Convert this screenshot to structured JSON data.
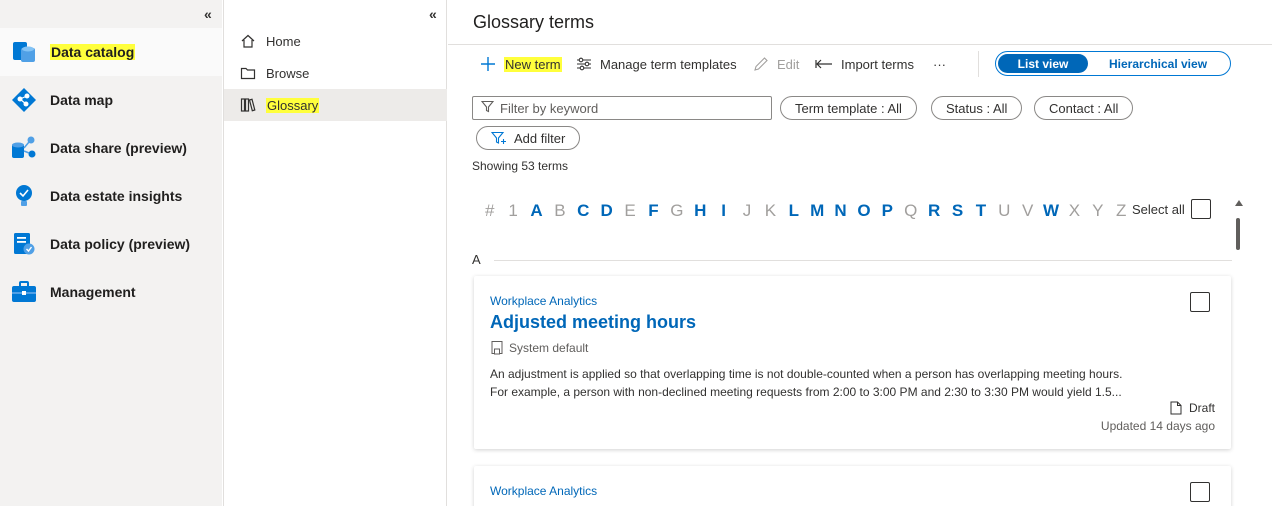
{
  "leftnav": {
    "items": [
      {
        "label": "Data catalog",
        "icon": "data-catalog-icon"
      },
      {
        "label": "Data map",
        "icon": "data-map-icon"
      },
      {
        "label": "Data share (preview)",
        "icon": "data-share-icon"
      },
      {
        "label": "Data estate insights",
        "icon": "insights-icon"
      },
      {
        "label": "Data policy (preview)",
        "icon": "data-policy-icon"
      },
      {
        "label": "Management",
        "icon": "management-icon"
      }
    ]
  },
  "subnav": {
    "items": [
      {
        "label": "Home",
        "icon": "home-icon"
      },
      {
        "label": "Browse",
        "icon": "folder-icon"
      },
      {
        "label": "Glossary",
        "icon": "book-icon"
      }
    ]
  },
  "main": {
    "title": "Glossary terms",
    "toolbar": {
      "new_term": "New term",
      "manage_templates": "Manage term templates",
      "edit": "Edit",
      "import_terms": "Import terms",
      "more": "···",
      "list_view": "List view",
      "hierarchical_view": "Hierarchical view"
    },
    "filter": {
      "placeholder": "Filter by keyword",
      "term_template": "Term template : All",
      "status": "Status : All",
      "contact": "Contact : All",
      "add_filter": "Add filter"
    },
    "showing": "Showing 53 terms",
    "alphabet": [
      {
        "c": "#",
        "on": false
      },
      {
        "c": "1",
        "on": false
      },
      {
        "c": "A",
        "on": true
      },
      {
        "c": "B",
        "on": false
      },
      {
        "c": "C",
        "on": true
      },
      {
        "c": "D",
        "on": true
      },
      {
        "c": "E",
        "on": false
      },
      {
        "c": "F",
        "on": true
      },
      {
        "c": "G",
        "on": false
      },
      {
        "c": "H",
        "on": true
      },
      {
        "c": "I",
        "on": true
      },
      {
        "c": "J",
        "on": false
      },
      {
        "c": "K",
        "on": false
      },
      {
        "c": "L",
        "on": true
      },
      {
        "c": "M",
        "on": true
      },
      {
        "c": "N",
        "on": true
      },
      {
        "c": "O",
        "on": true
      },
      {
        "c": "P",
        "on": true
      },
      {
        "c": "Q",
        "on": false
      },
      {
        "c": "R",
        "on": true
      },
      {
        "c": "S",
        "on": true
      },
      {
        "c": "T",
        "on": true
      },
      {
        "c": "U",
        "on": false
      },
      {
        "c": "V",
        "on": false
      },
      {
        "c": "W",
        "on": true
      },
      {
        "c": "X",
        "on": false
      },
      {
        "c": "Y",
        "on": false
      },
      {
        "c": "Z",
        "on": false
      }
    ],
    "select_all": "Select all",
    "section_letter": "A",
    "terms": [
      {
        "template": "Workplace Analytics",
        "name": "Adjusted meeting hours",
        "source": "System default",
        "description_line1": "An adjustment is applied so that overlapping time is not double-counted when a person has overlapping meeting hours.",
        "description_line2": "For example, a person with non-declined meeting requests from 2:00 to 3:00 PM and 2:30 to 3:30 PM would yield 1.5...",
        "status": "Draft",
        "updated": "Updated 14 days ago"
      },
      {
        "template": "Workplace Analytics"
      }
    ]
  },
  "colors": {
    "accent": "#0067b8",
    "highlight": "#ffff3c",
    "nav_bg": "#f3f2f1"
  }
}
